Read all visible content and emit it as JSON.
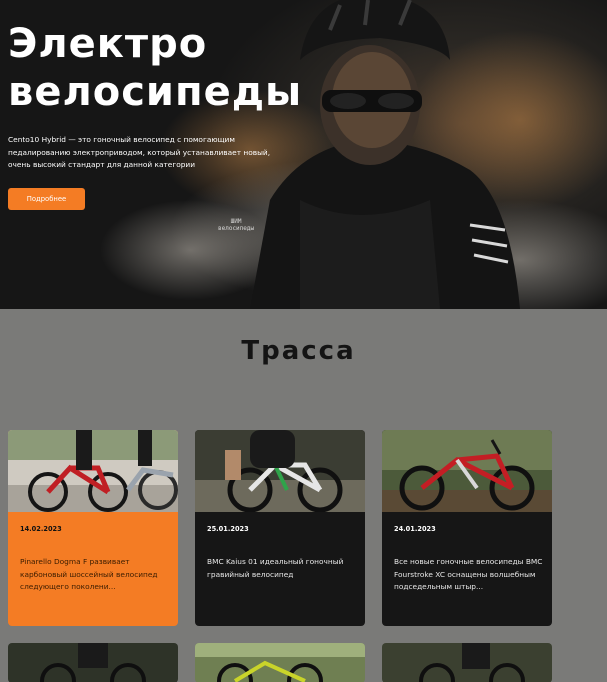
{
  "hero": {
    "title_line1": "Электро",
    "title_line2": "велосипеды",
    "description": "Cento10 Hybrid — это гоночный велосипед с помогающим педалированию электроприводом, который устанавливает новый, очень высокий стандарт для данной категории",
    "button_label": "Подробнее",
    "logo_line1": "ШИМ",
    "logo_line2": "велосипеды"
  },
  "section": {
    "title": "Трасса"
  },
  "cards": [
    {
      "date": "14.02.2023",
      "text": "Pinarello Dogma F развивает карбоновый шоссейный велосипед следующего поколени...",
      "highlight": true
    },
    {
      "date": "25.01.2023",
      "text": "BMC Kaius 01 идеальный гоночный гравийный велосипед",
      "highlight": false
    },
    {
      "date": "24.01.2023",
      "text": "Все новые гоночные велосипеды BMC Fourstroke XC оснащены волшебным подседельным штыр...",
      "highlight": false
    }
  ],
  "colors": {
    "accent": "#f47c24",
    "background": "#7a7a78",
    "card_dark": "#161616"
  }
}
